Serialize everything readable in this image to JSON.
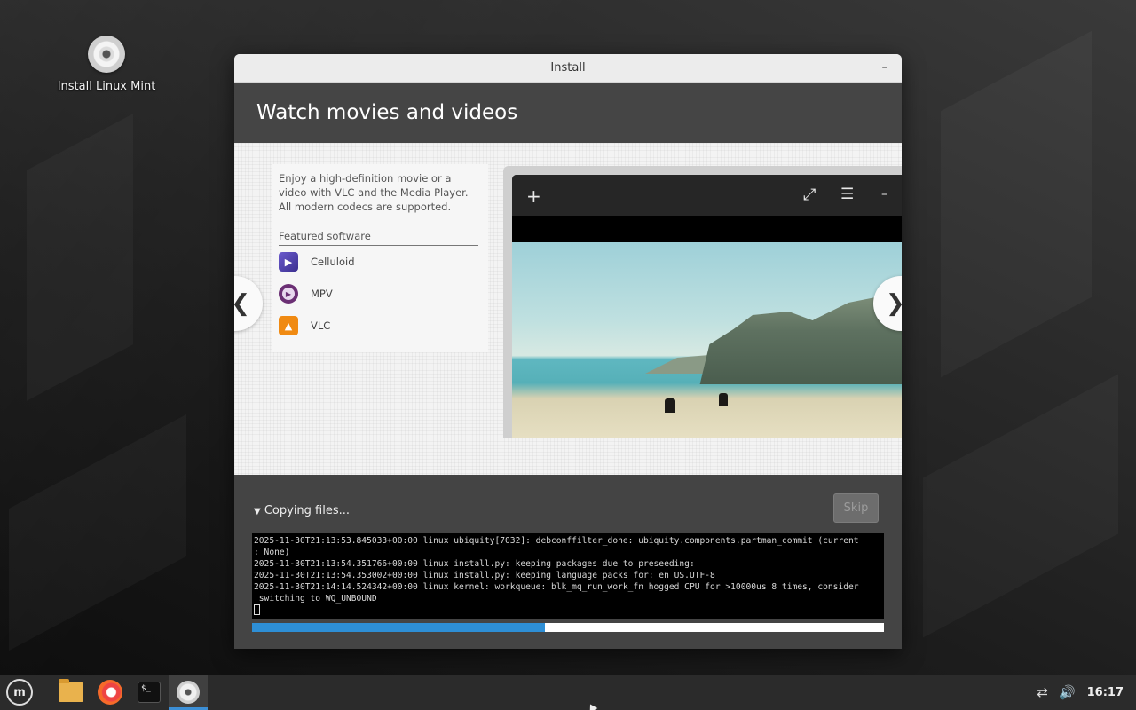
{
  "desktop": {
    "icon_label": "Install Linux Mint"
  },
  "window": {
    "title": "Install",
    "minimize_label": "–",
    "slide_title": "Watch movies and videos",
    "description": "Enjoy a high-definition movie or a video with VLC and the Media Player. All modern codecs are supported.",
    "featured_title": "Featured software",
    "apps": [
      {
        "name": "Celluloid",
        "icon": "celluloid-icon"
      },
      {
        "name": "MPV",
        "icon": "mpv-icon"
      },
      {
        "name": "VLC",
        "icon": "vlc-icon"
      }
    ],
    "prev_arrow": "❮",
    "next_arrow": "❯",
    "player": {
      "add_glyph": "+",
      "fullscreen_glyph": "⤢",
      "menu_glyph": "☰",
      "minimize_glyph": "–"
    }
  },
  "progress": {
    "status": "Copying files...",
    "skip_label": "Skip",
    "log_lines": [
      "2025-11-30T21:13:53.845033+00:00 linux ubiquity[7032]: debconffilter_done: ubiquity.components.partman_commit (current",
      ": None)",
      "2025-11-30T21:13:54.351766+00:00 linux install.py: keeping packages due to preseeding:",
      "2025-11-30T21:13:54.353002+00:00 linux install.py: keeping language packs for: en_US.UTF-8",
      "2025-11-30T21:14:14.524342+00:00 linux kernel: workqueue: blk_mq_run_work_fn hogged CPU for >10000us 8 times, consider",
      " switching to WQ_UNBOUND"
    ],
    "percent": 46.3,
    "accent_color": "#2e8fd6"
  },
  "taskbar": {
    "apps": [
      "mint-menu-icon",
      "files-icon",
      "firefox-icon",
      "terminal-icon",
      "installer-disc-icon"
    ],
    "terminal_glyph": "$_",
    "clock": "16:17",
    "tray": [
      "network-icon",
      "volume-icon"
    ]
  }
}
